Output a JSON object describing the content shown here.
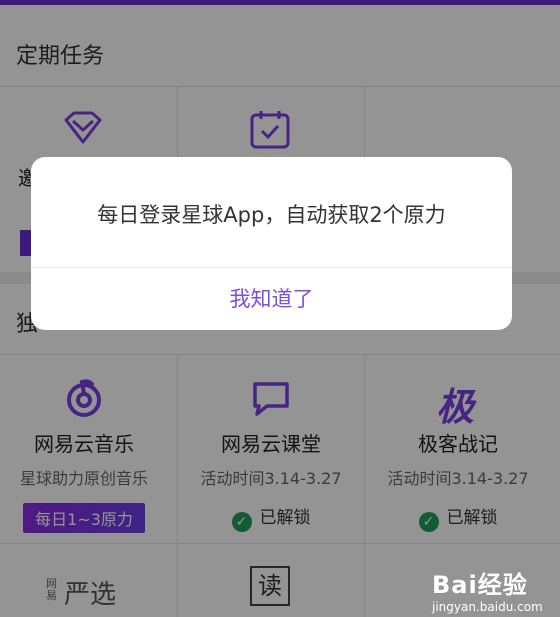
{
  "sections": {
    "periodic_title": "定期任务",
    "exclusive_title_partial": "独"
  },
  "periodic_partial_label": "邀",
  "cells": [
    {
      "title": "网易云音乐",
      "sub": "星球助力原创音乐",
      "pill": "每日1~3原力",
      "icon": "netease-music-icon"
    },
    {
      "title": "网易云课堂",
      "sub": "活动时间3.14-3.27",
      "status": "已解锁",
      "icon": "chat-bubble-icon"
    },
    {
      "title": "极客战记",
      "sub": "活动时间3.14-3.27",
      "status": "已解锁",
      "icon": "ji-logo-icon",
      "icon_text": "极"
    }
  ],
  "bottom_row": {
    "yanxuan_small": "网易",
    "yanxuan": "严选",
    "seal_char": "读"
  },
  "dialog": {
    "message": "每日登录星球App，自动获取2个原力",
    "button": "我知道了"
  },
  "watermark": {
    "logo": "Bai经验",
    "url": "jingyan.baidu.com"
  },
  "colors": {
    "accent": "#6a2ad8",
    "check": "#1f9e5b",
    "dialog_button": "#7a4fe0"
  }
}
